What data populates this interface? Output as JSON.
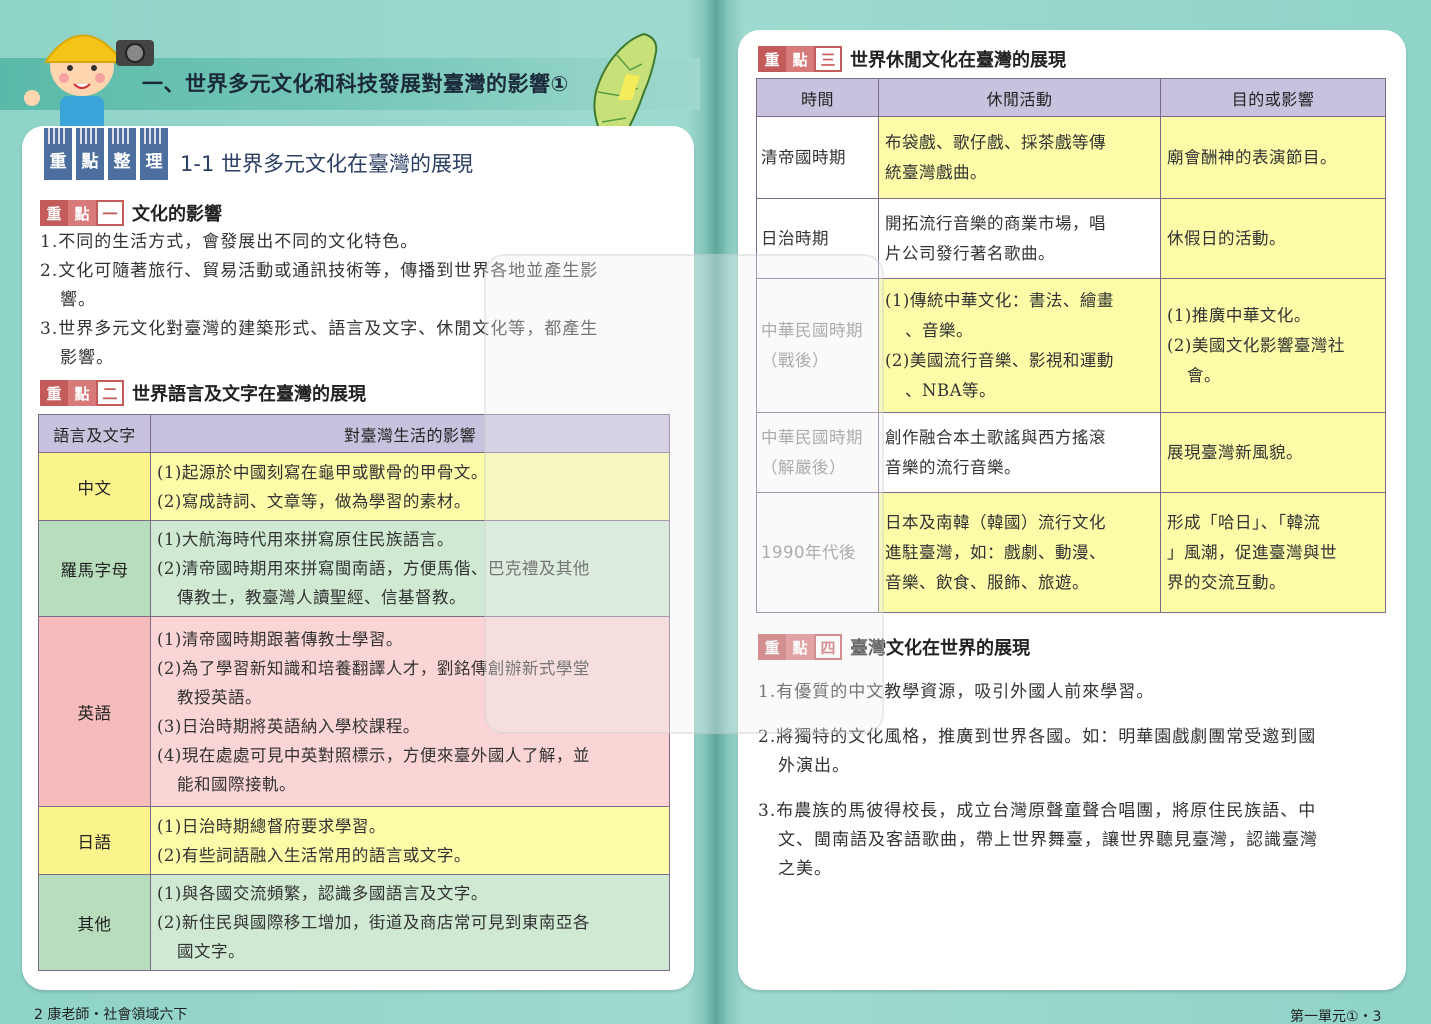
{
  "left_page": {
    "main_title": "一、世界多元文化和科技發展對臺灣的影響①",
    "tags": [
      "重",
      "點",
      "整",
      "理"
    ],
    "section_title": "1-1 世界多元文化在臺灣的展現",
    "kp1": {
      "b1": "重",
      "b2": "點",
      "num": "一",
      "title": "文化的影響",
      "items": [
        "1.不同的生活方式，會發展出不同的文化特色。",
        "2.文化可隨著旅行、貿易活動或通訊技術等，傳播到世界各地並產生影",
        "響。",
        "3.世界多元文化對臺灣的建築形式、語言及文字、休閒文化等，都產生",
        "影響。"
      ]
    },
    "kp2": {
      "b1": "重",
      "b2": "點",
      "num": "二",
      "title": "世界語言及文字在臺灣的展現",
      "headers": [
        "語言及文字",
        "對臺灣生活的影響"
      ],
      "rows": [
        {
          "label": "中文",
          "lines": [
            "(1)起源於中國刻寫在龜甲或獸骨的甲骨文。",
            "(2)寫成詩詞、文章等，做為學習的素材。"
          ]
        },
        {
          "label": "羅馬字母",
          "lines": [
            "(1)大航海時代用來拼寫原住民族語言。",
            "(2)清帝國時期用來拼寫閩南語，方便馬偕、巴克禮及其他",
            "傳教士，教臺灣人讀聖經、信基督教。"
          ]
        },
        {
          "label": "英語",
          "lines": [
            "(1)清帝國時期跟著傳教士學習。",
            "(2)為了學習新知識和培養翻譯人才，劉銘傳創辦新式學堂",
            "教授英語。",
            "(3)日治時期將英語納入學校課程。",
            "(4)現在處處可見中英對照標示，方便來臺外國人了解，並",
            "能和國際接軌。"
          ]
        },
        {
          "label": "日語",
          "lines": [
            "(1)日治時期總督府要求學習。",
            "(2)有些詞語融入生活常用的語言或文字。"
          ]
        },
        {
          "label": "其他",
          "lines": [
            "(1)與各國交流頻繁，認識多國語言及文字。",
            "(2)新住民與國際移工增加，街道及商店常可見到東南亞各",
            "國文字。"
          ]
        }
      ]
    },
    "footer": "2 康老師・社會領域六下"
  },
  "right_page": {
    "kp3": {
      "b1": "重",
      "b2": "點",
      "num": "三",
      "title": "世界休閒文化在臺灣的展現",
      "headers": [
        "時間",
        "休閒活動",
        "目的或影響"
      ],
      "rows": [
        {
          "era": "清帝國時期",
          "activity": [
            "布袋戲、歌仔戲、採茶戲等傳",
            "統臺灣戲曲。"
          ],
          "effect": [
            "廟會酬神的表演節目。"
          ]
        },
        {
          "era": "日治時期",
          "activity": [
            "開拓流行音樂的商業市場，唱",
            "片公司發行著名歌曲。"
          ],
          "effect": [
            "休假日的活動。"
          ]
        },
        {
          "era": "中華民國時期\n（戰後）",
          "activity": [
            "(1)傳統中華文化：書法、繪畫",
            "、音樂。",
            "(2)美國流行音樂、影視和運動",
            "、NBA等。"
          ],
          "effect": [
            "(1)推廣中華文化。",
            "(2)美國文化影響臺灣社",
            "會。"
          ]
        },
        {
          "era": "中華民國時期\n（解嚴後）",
          "activity": [
            "創作融合本土歌謠與西方搖滾",
            "音樂的流行音樂。"
          ],
          "effect": [
            "展現臺灣新風貌。"
          ]
        },
        {
          "era": "1990年代後",
          "activity": [
            "日本及南韓（韓國）流行文化",
            "進駐臺灣，如：戲劇、動漫、",
            "音樂、飲食、服飾、旅遊。"
          ],
          "effect": [
            "形成「哈日」、「韓流",
            "」風潮，促進臺灣與世",
            "界的交流互動。"
          ]
        }
      ]
    },
    "kp4": {
      "b1": "重",
      "b2": "點",
      "num": "四",
      "title": "臺灣文化在世界的展現",
      "items": [
        "1.有優質的中文教學資源，吸引外國人前來學習。",
        "2.將獨特的文化風格，推廣到世界各國。如：明華園戲劇團常受邀到國",
        "外演出。",
        "3.布農族的馬彼得校長，成立台灣原聲童聲合唱團，將原住民族語、中",
        "文、閩南語及客語歌曲，帶上世界舞臺，讓世界聽見臺灣，認識臺灣",
        "之美。"
      ]
    },
    "footer": "第一單元①・3"
  },
  "colors": {
    "red": "#e03030",
    "yellow": "#fbfba8",
    "green": "#cfe9d2",
    "pink": "#fbd5d5",
    "header": "#c9c2de",
    "kp_red": "#c45b5b"
  }
}
